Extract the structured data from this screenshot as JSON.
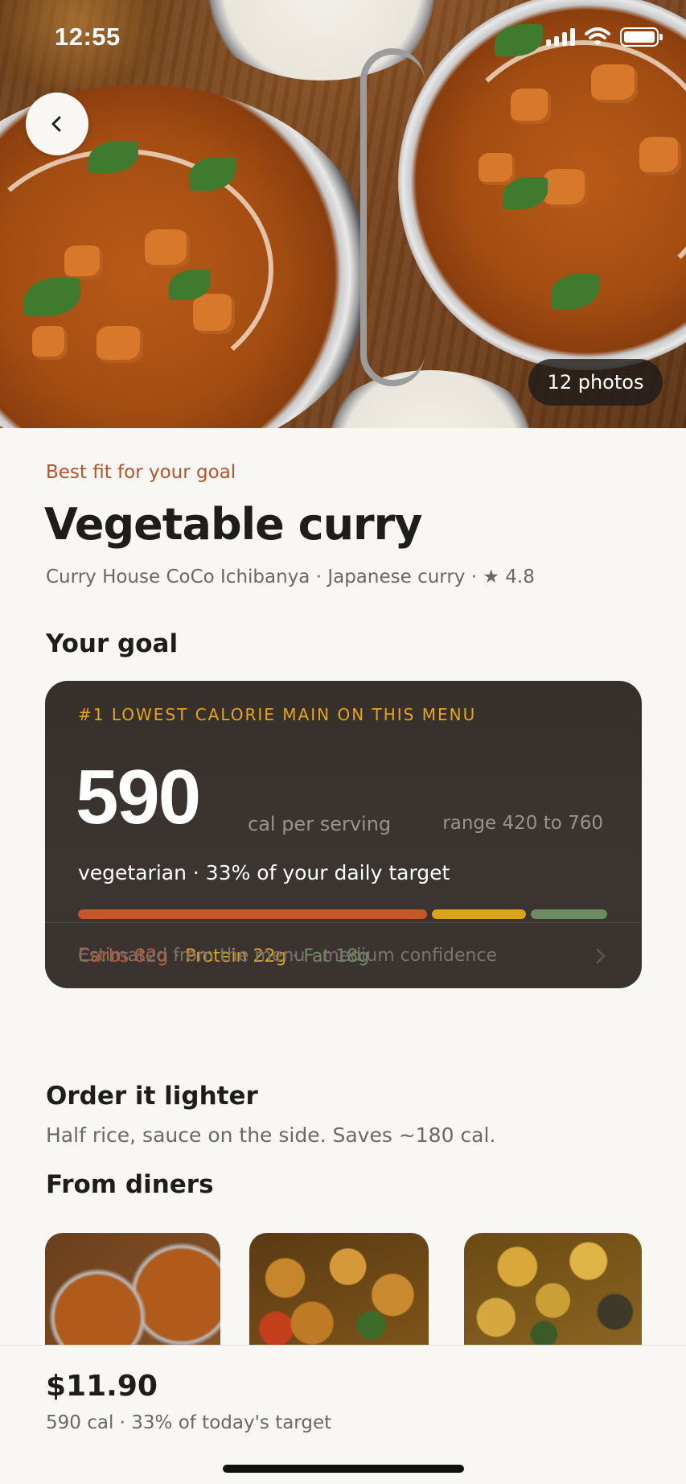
{
  "status_bar": {
    "time": "12:55"
  },
  "hero": {
    "photos_label": "12 photos"
  },
  "dish": {
    "eyebrow": "Best fit for your goal",
    "title": "Vegetable curry",
    "meta": "Curry House CoCo Ichibanya · Japanese curry · ★ 4.8"
  },
  "goal": {
    "heading": "Your goal",
    "badge": "#1 LOWEST CALORIE MAIN ON THIS MENU",
    "calories": "590",
    "unit": "cal per serving",
    "range": "range 420 to 760",
    "subtitle": "vegetarian · 33% of your daily target",
    "macros": [
      {
        "label": "Carbs 82g",
        "grams": 82,
        "color": "#c4572a"
      },
      {
        "label": "Protein 22g",
        "grams": 22,
        "color": "#d9a41a"
      },
      {
        "label": "Fat 18g",
        "grams": 18,
        "color": "#6e8c62"
      }
    ],
    "separator": "·",
    "footer": "Estimated from the menu · medium confidence"
  },
  "lighter": {
    "heading": "Order it lighter",
    "text": "Half rice, sauce on the side. Saves ~180 cal."
  },
  "diners": {
    "heading": "From diners"
  },
  "bottom": {
    "price": "$11.90",
    "sub": "590 cal · 33% of today's target"
  },
  "colors": {
    "accent": "#b5532a",
    "card_bg": "#38312d",
    "badge": "#e5a617"
  }
}
